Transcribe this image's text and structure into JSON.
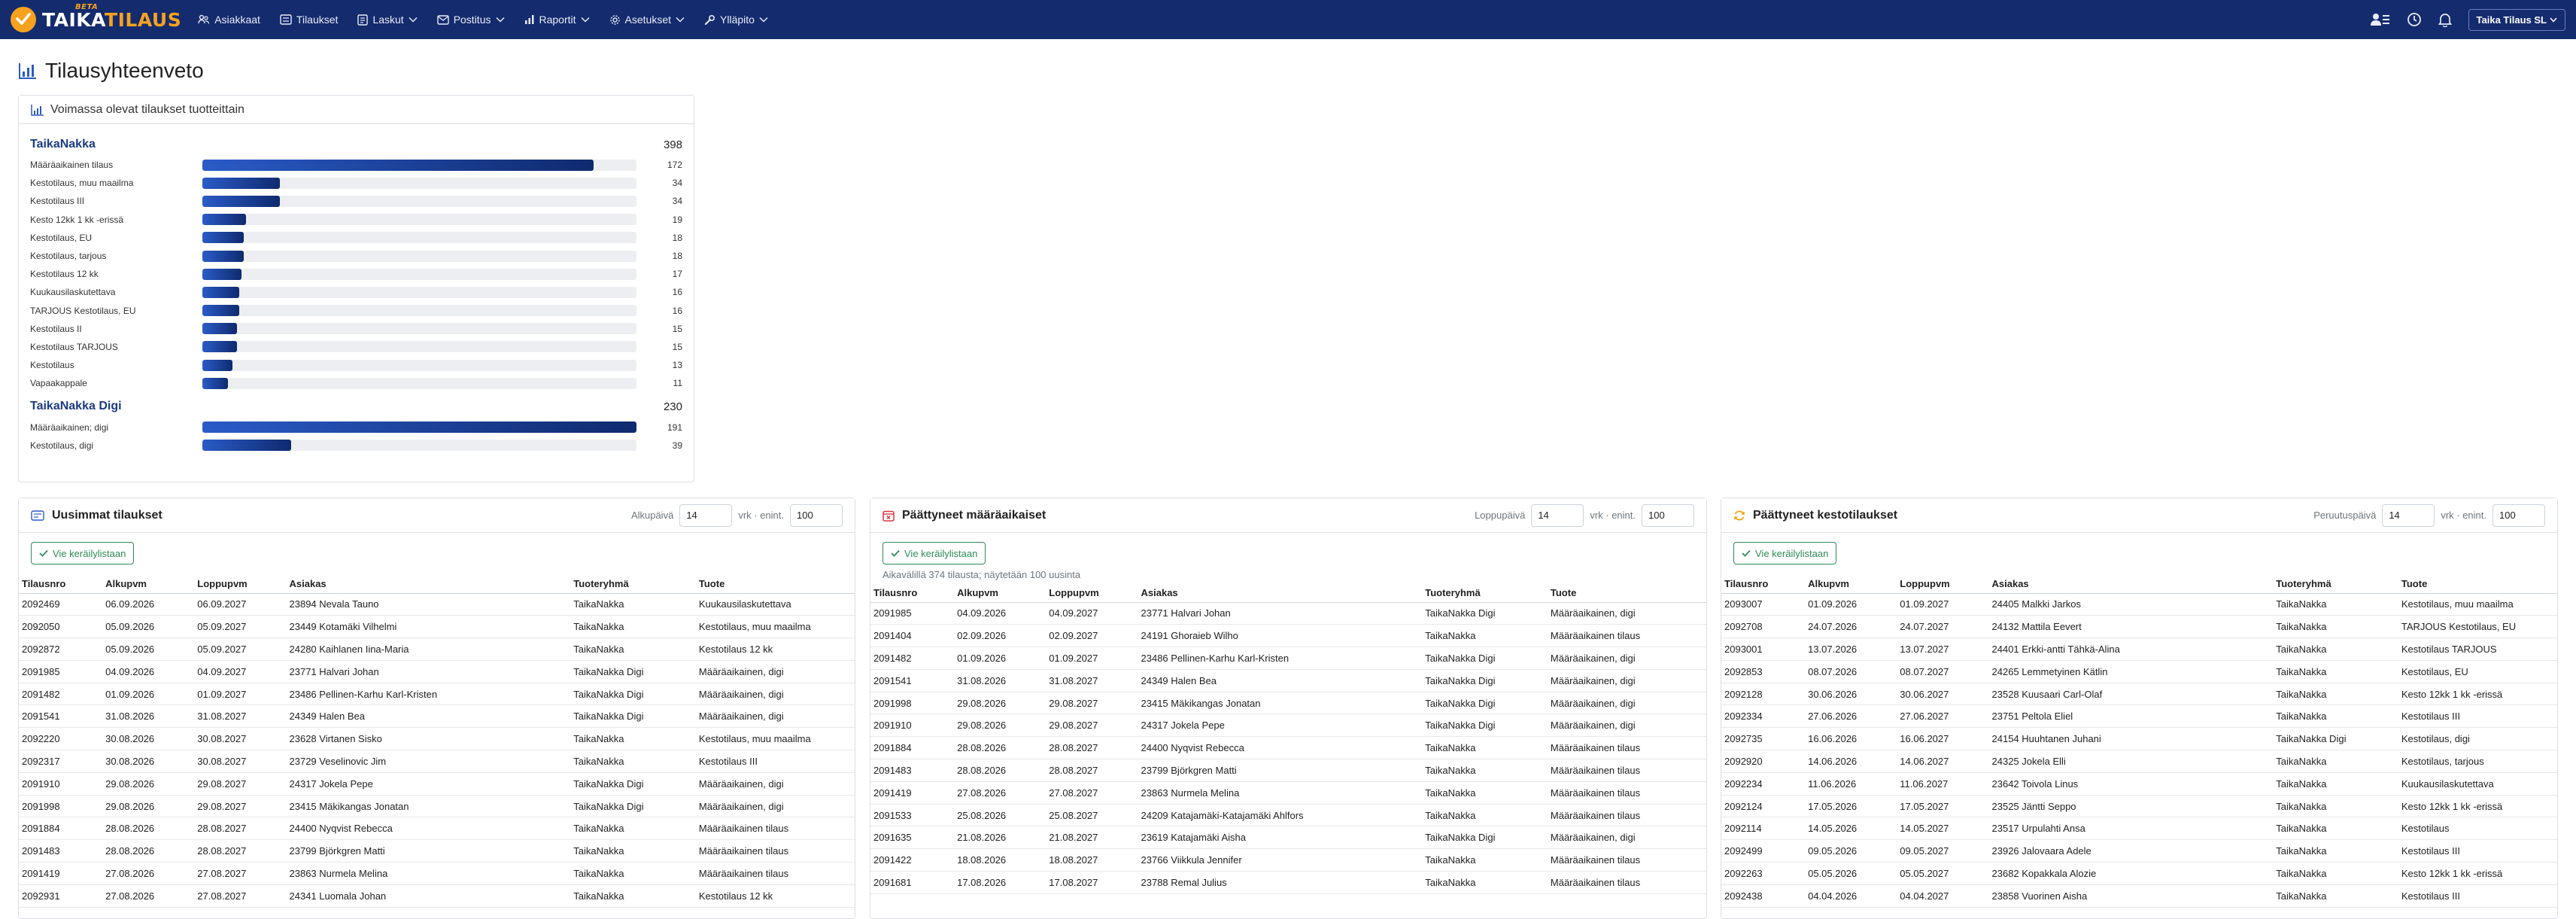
{
  "nav": {
    "brand_part1": "TAIKA",
    "brand_part2": "TILAUS",
    "brand_sup": "BETA",
    "items": [
      "Asiakkaat",
      "Tilaukset",
      "Laskut",
      "Postitus",
      "Raportit",
      "Asetukset",
      "Ylläpito"
    ],
    "user": "Taika Tilaus SL"
  },
  "page_title": "Tilausyhteenveto",
  "products": {
    "title": "Voimassa olevat tilaukset tuotteittain",
    "groups": [
      {
        "name": "TaikaNakka",
        "total": "398",
        "rows": [
          {
            "label": "Määräaikainen tilaus",
            "value": 172
          },
          {
            "label": "Kestotilaus, muu maailma",
            "value": 34
          },
          {
            "label": "Kestotilaus III",
            "value": 34
          },
          {
            "label": "Kesto 12kk 1 kk -erissä",
            "value": 19
          },
          {
            "label": "Kestotilaus, EU",
            "value": 18
          },
          {
            "label": "Kestotilaus, tarjous",
            "value": 18
          },
          {
            "label": "Kestotilaus 12 kk",
            "value": 17
          },
          {
            "label": "Kuukausilaskutettava",
            "value": 16
          },
          {
            "label": "TARJOUS Kestotilaus, EU",
            "value": 16
          },
          {
            "label": "Kestotilaus II",
            "value": 15
          },
          {
            "label": "Kestotilaus TARJOUS",
            "value": 15
          },
          {
            "label": "Kestotilaus",
            "value": 13
          },
          {
            "label": "Vapaakappale",
            "value": 11
          }
        ]
      },
      {
        "name": "TaikaNakka Digi",
        "total": "230",
        "rows": [
          {
            "label": "Määräaikainen; digi",
            "value": 191
          },
          {
            "label": "Kestotilaus, digi",
            "value": 39
          }
        ]
      }
    ],
    "max_value": 191
  },
  "panels": [
    {
      "title": "Uusimmat tilaukset",
      "filter_label": "Alkupäivä",
      "filter_days": "14",
      "filter_unit": "vrk · enint.",
      "filter_max": "100",
      "button": "Vie keräilylistaan",
      "info": "",
      "columns": [
        "Tilausnro",
        "Alkupvm",
        "Loppupvm",
        "Asiakas",
        "Tuoteryhmä",
        "Tuote"
      ],
      "rows": [
        [
          "2092469",
          "06.09.2026",
          "06.09.2027",
          "23894 Nevala Tauno",
          "TaikaNakka",
          "Kuukausilaskutettava"
        ],
        [
          "2092050",
          "05.09.2026",
          "05.09.2027",
          "23449 Kotamäki Vilhelmi",
          "TaikaNakka",
          "Kestotilaus, muu maailma"
        ],
        [
          "2092872",
          "05.09.2026",
          "05.09.2027",
          "24280 Kaihlanen Iina-Maria",
          "TaikaNakka",
          "Kestotilaus 12 kk"
        ],
        [
          "2091985",
          "04.09.2026",
          "04.09.2027",
          "23771 Halvari Johan",
          "TaikaNakka Digi",
          "Määräaikainen, digi"
        ],
        [
          "2091482",
          "01.09.2026",
          "01.09.2027",
          "23486 Pellinen-Karhu Karl-Kristen",
          "TaikaNakka Digi",
          "Määräaikainen, digi"
        ],
        [
          "2091541",
          "31.08.2026",
          "31.08.2027",
          "24349 Halen Bea",
          "TaikaNakka Digi",
          "Määräaikainen, digi"
        ],
        [
          "2092220",
          "30.08.2026",
          "30.08.2027",
          "23628 Virtanen Sisko",
          "TaikaNakka",
          "Kestotilaus, muu maailma"
        ],
        [
          "2092317",
          "30.08.2026",
          "30.08.2027",
          "23729 Veselinovic Jim",
          "TaikaNakka",
          "Kestotilaus III"
        ],
        [
          "2091910",
          "29.08.2026",
          "29.08.2027",
          "24317 Jokela Pepe",
          "TaikaNakka Digi",
          "Määräaikainen, digi"
        ],
        [
          "2091998",
          "29.08.2026",
          "29.08.2027",
          "23415 Mäkikangas Jonatan",
          "TaikaNakka Digi",
          "Määräaikainen, digi"
        ],
        [
          "2091884",
          "28.08.2026",
          "28.08.2027",
          "24400 Nyqvist Rebecca",
          "TaikaNakka",
          "Määräaikainen tilaus"
        ],
        [
          "2091483",
          "28.08.2026",
          "28.08.2027",
          "23799 Björkgren Matti",
          "TaikaNakka",
          "Määräaikainen tilaus"
        ],
        [
          "2091419",
          "27.08.2026",
          "27.08.2027",
          "23863 Nurmela Melina",
          "TaikaNakka",
          "Määräaikainen tilaus"
        ],
        [
          "2092931",
          "27.08.2026",
          "27.08.2027",
          "24341 Luomala Johan",
          "TaikaNakka",
          "Kestotilaus 12 kk"
        ]
      ]
    },
    {
      "title": "Päättyneet määräaikaiset",
      "filter_label": "Loppupäivä",
      "filter_days": "14",
      "filter_unit": "vrk · enint.",
      "filter_max": "100",
      "button": "Vie keräilylistaan",
      "info": "Aikavälillä 374 tilausta; näytetään 100 uusinta",
      "columns": [
        "Tilausnro",
        "Alkupvm",
        "Loppupvm",
        "Asiakas",
        "Tuoteryhmä",
        "Tuote"
      ],
      "rows": [
        [
          "2091985",
          "04.09.2026",
          "04.09.2027",
          "23771 Halvari Johan",
          "TaikaNakka Digi",
          "Määräaikainen, digi"
        ],
        [
          "2091404",
          "02.09.2026",
          "02.09.2027",
          "24191 Ghoraieb Wilho",
          "TaikaNakka",
          "Määräaikainen tilaus"
        ],
        [
          "2091482",
          "01.09.2026",
          "01.09.2027",
          "23486 Pellinen-Karhu Karl-Kristen",
          "TaikaNakka Digi",
          "Määräaikainen, digi"
        ],
        [
          "2091541",
          "31.08.2026",
          "31.08.2027",
          "24349 Halen Bea",
          "TaikaNakka Digi",
          "Määräaikainen, digi"
        ],
        [
          "2091998",
          "29.08.2026",
          "29.08.2027",
          "23415 Mäkikangas Jonatan",
          "TaikaNakka Digi",
          "Määräaikainen, digi"
        ],
        [
          "2091910",
          "29.08.2026",
          "29.08.2027",
          "24317 Jokela Pepe",
          "TaikaNakka Digi",
          "Määräaikainen, digi"
        ],
        [
          "2091884",
          "28.08.2026",
          "28.08.2027",
          "24400 Nyqvist Rebecca",
          "TaikaNakka",
          "Määräaikainen tilaus"
        ],
        [
          "2091483",
          "28.08.2026",
          "28.08.2027",
          "23799 Björkgren Matti",
          "TaikaNakka",
          "Määräaikainen tilaus"
        ],
        [
          "2091419",
          "27.08.2026",
          "27.08.2027",
          "23863 Nurmela Melina",
          "TaikaNakka",
          "Määräaikainen tilaus"
        ],
        [
          "2091533",
          "25.08.2026",
          "25.08.2027",
          "24209 Katajamäki-Katajamäki Ahlfors",
          "TaikaNakka",
          "Määräaikainen tilaus"
        ],
        [
          "2091635",
          "21.08.2026",
          "21.08.2027",
          "23619 Katajamäki Aisha",
          "TaikaNakka Digi",
          "Määräaikainen, digi"
        ],
        [
          "2091422",
          "18.08.2026",
          "18.08.2027",
          "23766 Viikkula Jennifer",
          "TaikaNakka",
          "Määräaikainen tilaus"
        ],
        [
          "2091681",
          "17.08.2026",
          "17.08.2027",
          "23788 Remal Julius",
          "TaikaNakka",
          "Määräaikainen tilaus"
        ]
      ]
    },
    {
      "title": "Päättyneet kestotilaukset",
      "filter_label": "Peruutuspäivä",
      "filter_days": "14",
      "filter_unit": "vrk · enint.",
      "filter_max": "100",
      "button": "Vie keräilylistaan",
      "info": "",
      "columns": [
        "Tilausnro",
        "Alkupvm",
        "Loppupvm",
        "Asiakas",
        "Tuoteryhmä",
        "Tuote"
      ],
      "rows": [
        [
          "2093007",
          "01.09.2026",
          "01.09.2027",
          "24405 Malkki Jarkos",
          "TaikaNakka",
          "Kestotilaus, muu maailma"
        ],
        [
          "2092708",
          "24.07.2026",
          "24.07.2027",
          "24132 Mattila Eevert",
          "TaikaNakka",
          "TARJOUS Kestotilaus, EU"
        ],
        [
          "2093001",
          "13.07.2026",
          "13.07.2027",
          "24401 Erkki-antti Tähkä-Alina",
          "TaikaNakka",
          "Kestotilaus TARJOUS"
        ],
        [
          "2092853",
          "08.07.2026",
          "08.07.2027",
          "24265 Lemmetyinen Kätlin",
          "TaikaNakka",
          "Kestotilaus, EU"
        ],
        [
          "2092128",
          "30.06.2026",
          "30.06.2027",
          "23528 Kuusaari Carl-Olaf",
          "TaikaNakka",
          "Kesto 12kk 1 kk -erissä"
        ],
        [
          "2092334",
          "27.06.2026",
          "27.06.2027",
          "23751 Peltola Eliel",
          "TaikaNakka",
          "Kestotilaus III"
        ],
        [
          "2092735",
          "16.06.2026",
          "16.06.2027",
          "24154 Huuhtanen Juhani",
          "TaikaNakka Digi",
          "Kestotilaus, digi"
        ],
        [
          "2092920",
          "14.06.2026",
          "14.06.2027",
          "24325 Jokela Elli",
          "TaikaNakka",
          "Kestotilaus, tarjous"
        ],
        [
          "2092234",
          "11.06.2026",
          "11.06.2027",
          "23642 Toivola Linus",
          "TaikaNakka",
          "Kuukausilaskutettava"
        ],
        [
          "2092124",
          "17.05.2026",
          "17.05.2027",
          "23525 Jäntti Seppo",
          "TaikaNakka",
          "Kesto 12kk 1 kk -erissä"
        ],
        [
          "2092114",
          "14.05.2026",
          "14.05.2027",
          "23517 Urpulahti Ansa",
          "TaikaNakka",
          "Kestotilaus"
        ],
        [
          "2092499",
          "09.05.2026",
          "09.05.2027",
          "23926 Jalovaara Adele",
          "TaikaNakka",
          "Kestotilaus III"
        ],
        [
          "2092263",
          "05.05.2026",
          "05.05.2027",
          "23682 Kopakkala Alozie",
          "TaikaNakka",
          "Kesto 12kk 1 kk -erissä"
        ],
        [
          "2092438",
          "04.04.2026",
          "04.04.2027",
          "23858 Vuorinen Aisha",
          "TaikaNakka",
          "Kestotilaus III"
        ]
      ]
    }
  ]
}
